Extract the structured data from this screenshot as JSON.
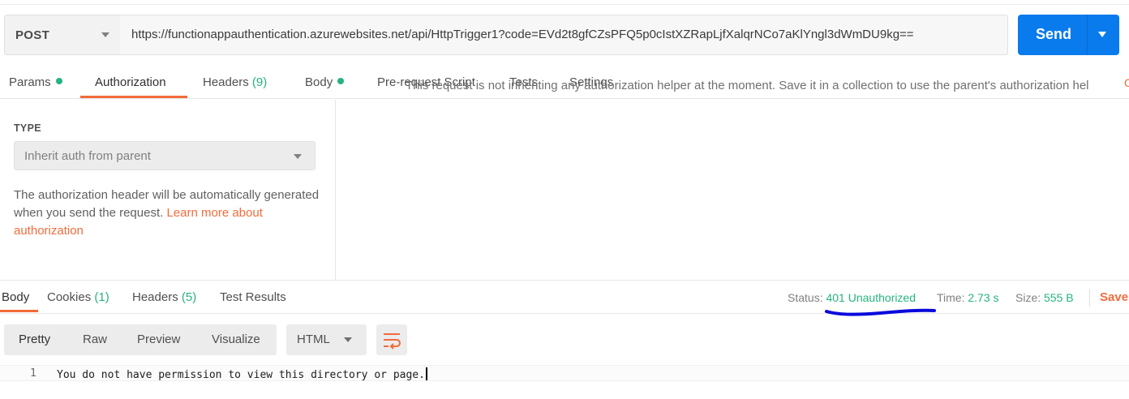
{
  "request": {
    "method": "POST",
    "url": "https://functionappauthentication.azurewebsites.net/api/HttpTrigger1?code=EVd2t8gfCZsPFQ5p0cIstXZRapLjfXalqrNCo7aKlYngl3dWmDU9kg==",
    "send_label": "Send"
  },
  "request_tabs": {
    "params": "Params",
    "authorization": "Authorization",
    "headers": "Headers",
    "headers_count": "(9)",
    "body": "Body",
    "pre_request": "Pre-request Script",
    "tests": "Tests",
    "settings": "Settings",
    "active": "Authorization"
  },
  "auth": {
    "type_label": "TYPE",
    "type_value": "Inherit auth from parent",
    "help_text": "The authorization header will be automatically generated when you send the request. ",
    "help_link": "Learn more about authorization",
    "right_message": "This request is not inheriting any authorization helper at the moment. Save it in a collection to use the parent's authorization hel"
  },
  "response_tabs": {
    "body": "Body",
    "cookies": "Cookies",
    "cookies_count": "(1)",
    "headers": "Headers",
    "headers_count": "(5)",
    "test_results": "Test Results",
    "active": "Body"
  },
  "response_meta": {
    "status_label": "Status:",
    "status_value": "401 Unauthorized",
    "time_label": "Time:",
    "time_value": "2.73 s",
    "size_label": "Size:",
    "size_value": "555 B",
    "save_label": "Save"
  },
  "response_toolbar": {
    "views": [
      "Pretty",
      "Raw",
      "Preview",
      "Visualize"
    ],
    "format": "HTML"
  },
  "response_body": {
    "line_number": "1",
    "line_text": "You do not have permission to view this directory or page."
  },
  "colors": {
    "accent": "#f26b3a",
    "send_button": "#097bed",
    "success": "#26b47f",
    "annotation": "#0a0adc"
  }
}
